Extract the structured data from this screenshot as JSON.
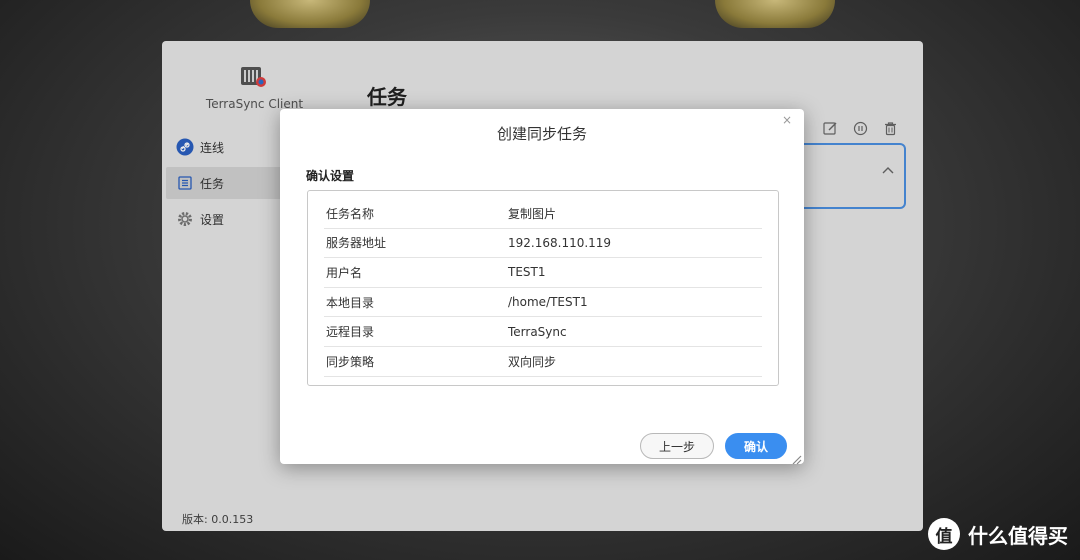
{
  "app": {
    "name": "TerraSync Client",
    "page_title": "任务",
    "version_label": "版本: 0.0.153"
  },
  "sidebar": {
    "items": [
      {
        "label": "连线",
        "icon": "link-icon",
        "active": false
      },
      {
        "label": "任务",
        "icon": "task-list-icon",
        "active": true
      },
      {
        "label": "设置",
        "icon": "gear-icon",
        "active": false
      }
    ]
  },
  "toolbar": {
    "icons": [
      "edit-icon",
      "pause-icon",
      "trash-icon"
    ]
  },
  "modal": {
    "title": "创建同步任务",
    "close_glyph": "×",
    "section_title": "确认设置",
    "rows": [
      {
        "key": "任务名称",
        "value": "复制图片"
      },
      {
        "key": "服务器地址",
        "value": "192.168.110.119"
      },
      {
        "key": "用户名",
        "value": "TEST1"
      },
      {
        "key": "本地目录",
        "value": "/home/TEST1"
      },
      {
        "key": "远程目录",
        "value": "TerraSync"
      },
      {
        "key": "同步策略",
        "value": "双向同步"
      }
    ],
    "prev_label": "上一步",
    "confirm_label": "确认"
  },
  "watermark": {
    "badge": "值",
    "text": "什么值得买"
  },
  "colors": {
    "accent": "#3a8ef0",
    "card_border": "#4a8fe0"
  }
}
